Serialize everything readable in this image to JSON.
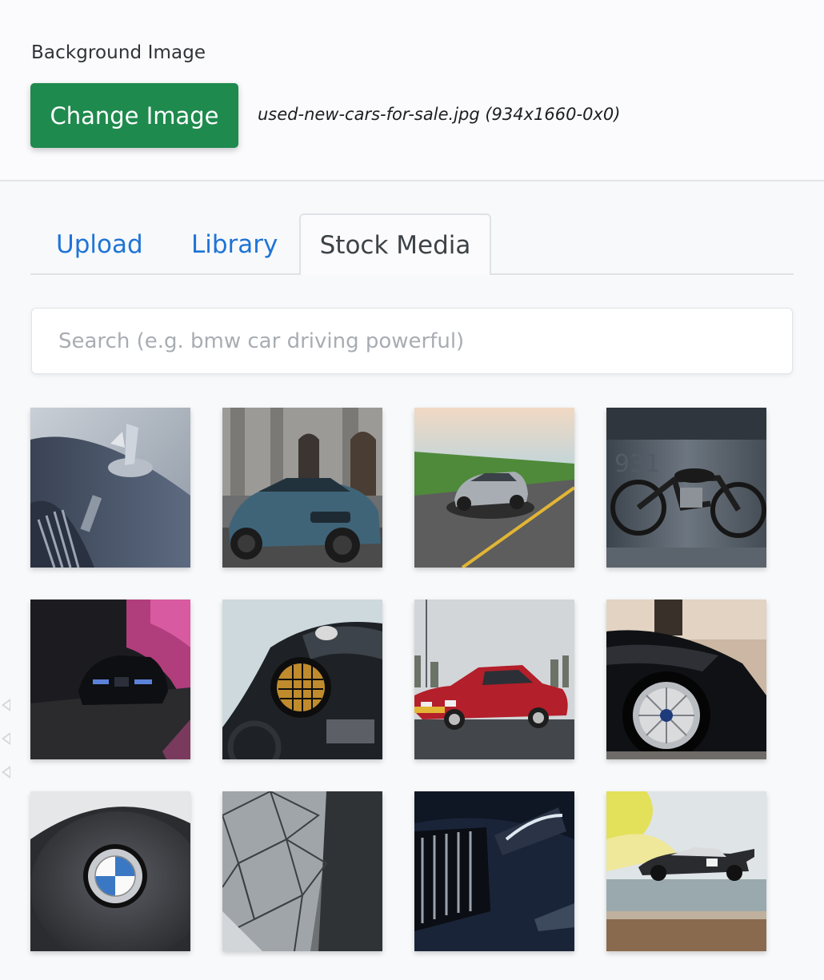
{
  "background_image": {
    "label": "Background Image",
    "change_button_label": "Change Image",
    "file_name": "used-new-cars-for-sale.jpg (934x1660-0x0)",
    "button_color": "#1f8a4e"
  },
  "tabs": [
    {
      "label": "Upload",
      "active": false
    },
    {
      "label": "Library",
      "active": false
    },
    {
      "label": "Stock Media",
      "active": true
    }
  ],
  "search": {
    "placeholder": "Search (e.g. bmw car driving powerful)",
    "value": ""
  },
  "gallery": {
    "items": [
      {
        "subject": "hood-ornament-closeup"
      },
      {
        "subject": "blue-bmw-in-front-of-building"
      },
      {
        "subject": "silver-bmw-driving-road"
      },
      {
        "subject": "vintage-motorcycle"
      },
      {
        "subject": "black-bmw-pink-foliage"
      },
      {
        "subject": "motorcycle-headlight"
      },
      {
        "subject": "red-classic-bmw"
      },
      {
        "subject": "black-car-wheel"
      },
      {
        "subject": "bmw-steering-wheel-logo"
      },
      {
        "subject": "geometric-glass-structure"
      },
      {
        "subject": "dark-bmw-grille"
      },
      {
        "subject": "race-car-on-track"
      }
    ]
  }
}
